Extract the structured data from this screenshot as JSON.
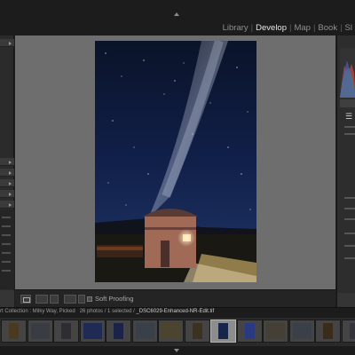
{
  "modules": [
    "Library",
    "Develop",
    "Map",
    "Book",
    "Sl"
  ],
  "active_module": "Develop",
  "toolbar": {
    "soft_proofing_label": "Soft Proofing"
  },
  "filmstrip": {
    "source": "rt Collection : Milky Way, Picked",
    "count": "26 photos / 1 selected /",
    "current_file": "_DSC6029-Enhanced-NR-Edit.tif",
    "thumbnails": [
      {
        "color": "#4a3a22",
        "orient": "portrait"
      },
      {
        "color": "#3a3c44",
        "orient": "landscape"
      },
      {
        "color": "#2d2d33",
        "orient": "portrait"
      },
      {
        "color": "#1f2a55",
        "orient": "landscape"
      },
      {
        "color": "#1b2448",
        "orient": "portrait"
      },
      {
        "color": "#39404a",
        "orient": "landscape"
      },
      {
        "color": "#4d4430",
        "orient": "landscape"
      },
      {
        "color": "#3c3220",
        "orient": "portrait"
      },
      {
        "color": "#16254a",
        "orient": "portrait"
      },
      {
        "color": "#2a3a80",
        "orient": "portrait"
      },
      {
        "color": "#444036",
        "orient": "landscape"
      },
      {
        "color": "#3a3f48",
        "orient": "landscape"
      },
      {
        "color": "#3a2c1a",
        "orient": "portrait"
      },
      {
        "color": "#34323a",
        "orient": "portrait"
      }
    ],
    "selected_index": 8
  }
}
